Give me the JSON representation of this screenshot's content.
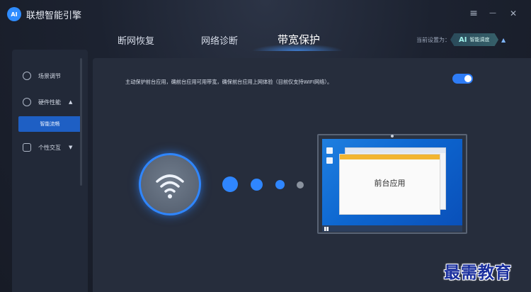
{
  "app": {
    "title": "联想智能引擎",
    "logo_text": "AI"
  },
  "window_controls": {
    "menu_icon": "≡",
    "minimize_icon": "—",
    "close_icon": "✕"
  },
  "tabs": [
    {
      "label": "断网恢复",
      "active": false
    },
    {
      "label": "网络诊断",
      "active": false
    },
    {
      "label": "带宽保护",
      "active": true
    }
  ],
  "mode": {
    "label": "当前设置为：",
    "badge": "AI",
    "value": "智能调度"
  },
  "sidebar": {
    "items": [
      {
        "label": "场景调节",
        "icon": "scene-icon"
      },
      {
        "label": "硬件性能",
        "icon": "gauge-icon",
        "caret": "▲"
      },
      {
        "label": "个性交互",
        "icon": "cloud-icon",
        "caret": "▼"
      }
    ],
    "sub_item": "智能流畅"
  },
  "main": {
    "description": "主动保护前台应用，确前台应用可用带宽，确保前台应用上网体验（目前仅支持WIFI网络）。",
    "toggle_on": true,
    "front_app_label": "前台应用"
  },
  "colors": {
    "accent": "#2f86ff",
    "toggle": "#2e7cf6",
    "sub_item_bg": "#1e5fc4"
  },
  "watermark": "最需教育"
}
